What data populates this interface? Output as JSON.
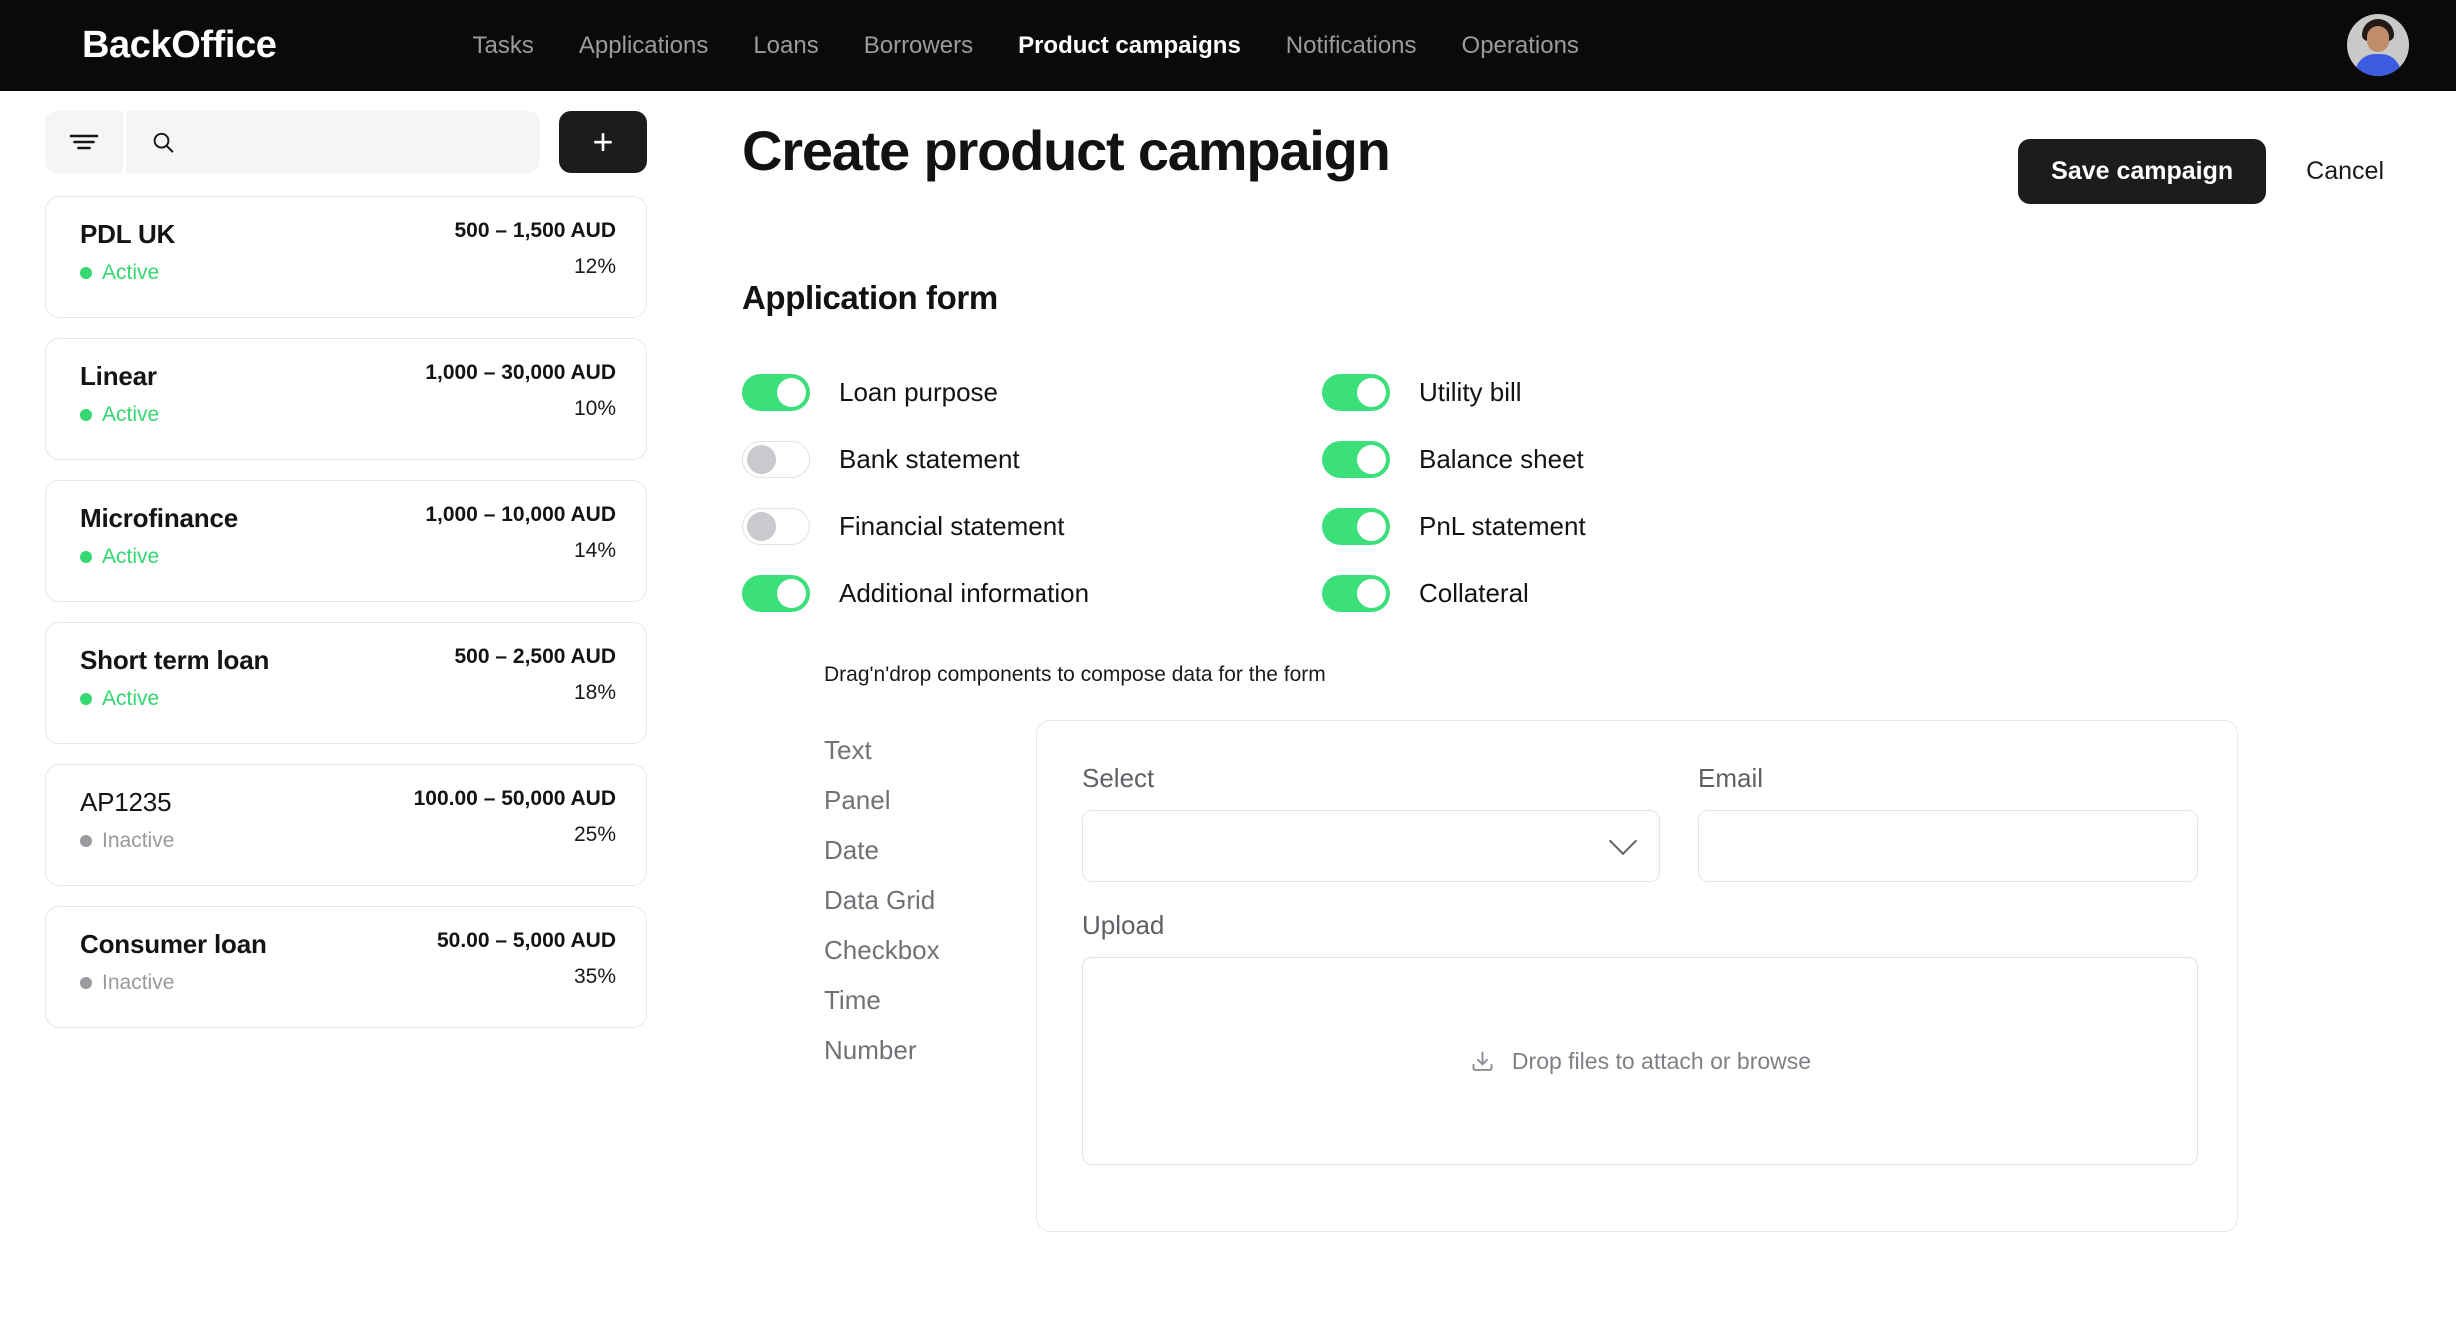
{
  "nav": {
    "brand": "BackOffice",
    "items": [
      {
        "label": "Tasks",
        "active": false
      },
      {
        "label": "Applications",
        "active": false
      },
      {
        "label": "Loans",
        "active": false
      },
      {
        "label": "Borrowers",
        "active": false
      },
      {
        "label": "Product campaigns",
        "active": true
      },
      {
        "label": "Notifications",
        "active": false
      },
      {
        "label": "Operations",
        "active": false
      }
    ],
    "avatar_icon": "user-avatar-photo"
  },
  "sidebar": {
    "filter_icon": "filter-lines-icon",
    "search_icon": "search-icon",
    "search_value": "",
    "search_placeholder": "",
    "add_label": "+",
    "campaigns": [
      {
        "name": "PDL UK",
        "status": "Active",
        "state": "active",
        "amount": "500 – 1,500 AUD",
        "rate": "12%"
      },
      {
        "name": "Linear",
        "status": "Active",
        "state": "active",
        "amount": "1,000 – 30,000 AUD",
        "rate": "10%"
      },
      {
        "name": "Microfinance",
        "status": "Active",
        "state": "active",
        "amount": "1,000 – 10,000 AUD",
        "rate": "14%"
      },
      {
        "name": "Short term loan",
        "status": "Active",
        "state": "active",
        "amount": "500 – 2,500 AUD",
        "rate": "18%"
      },
      {
        "name": "AP1235",
        "status": "Inactive",
        "state": "inactive",
        "amount": "100.00 – 50,000 AUD",
        "rate": "25%"
      },
      {
        "name": "Consumer loan",
        "status": "Inactive",
        "state": "inactive",
        "amount": "50.00 – 5,000 AUD",
        "rate": "35%"
      }
    ]
  },
  "main": {
    "title": "Create product campaign",
    "save_label": "Save campaign",
    "cancel_label": "Cancel",
    "section_title": "Application form",
    "toggles_left": [
      {
        "label": "Loan purpose",
        "on": true
      },
      {
        "label": "Bank statement",
        "on": false
      },
      {
        "label": "Financial statement",
        "on": false
      },
      {
        "label": "Additional information",
        "on": true
      }
    ],
    "toggles_right": [
      {
        "label": "Utility bill",
        "on": true
      },
      {
        "label": "Balance sheet",
        "on": true
      },
      {
        "label": "PnL statement",
        "on": true
      },
      {
        "label": "Collateral",
        "on": true
      }
    ],
    "builder": {
      "hint": "Drag'n'drop components to compose data for the form",
      "palette": [
        "Text",
        "Panel",
        "Date",
        "Data Grid",
        "Checkbox",
        "Time",
        "Number"
      ],
      "fields": {
        "select_label": "Select",
        "select_value": "",
        "select_icon": "chevron-down-icon",
        "email_label": "Email",
        "email_value": "",
        "upload_label": "Upload",
        "upload_icon": "download-tray-icon",
        "upload_text": "Drop files to attach or browse"
      }
    }
  },
  "colors": {
    "nav_bg": "#0a0a0a",
    "accent_green": "#3ce07a",
    "status_active": "#34d770",
    "status_inactive": "#9a9a9e",
    "dark_button": "#1c1c1c"
  }
}
